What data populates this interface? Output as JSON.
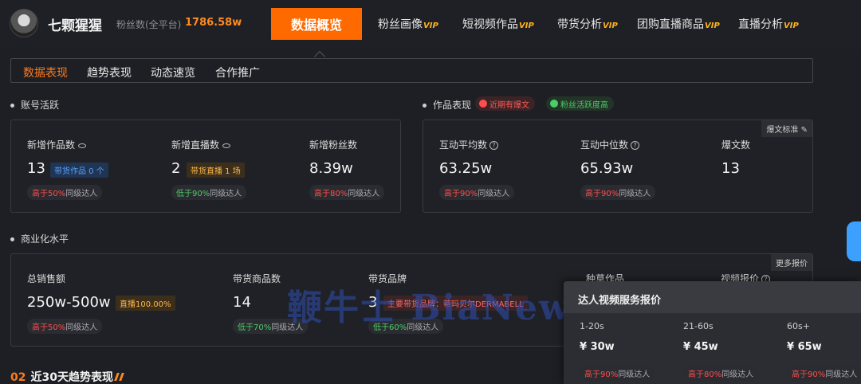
{
  "header": {
    "account_name": "七颗猩猩",
    "fans_label": "粉丝数(全平台)",
    "fans_value": "1786.58w",
    "nav_active": "数据概览",
    "nav_items": [
      {
        "label": "粉丝画像",
        "vip": "VIP"
      },
      {
        "label": "短视频作品",
        "vip": "VIP"
      },
      {
        "label": "带货分析",
        "vip": "VIP"
      },
      {
        "label": "团购直播商品",
        "vip": "VIP"
      },
      {
        "label": "直播分析",
        "vip": "VIP"
      }
    ]
  },
  "subtabs": [
    "数据表现",
    "趋势表现",
    "动态速览",
    "合作推广"
  ],
  "activity": {
    "title": "账号活跃",
    "metrics": [
      {
        "label": "新增作品数",
        "value": "13",
        "tag": "带货作品 0 个",
        "cmp_hl": "高于50%",
        "cmp_rest": "同级达人"
      },
      {
        "label": "新增直播数",
        "value": "2",
        "tag": "带货直播 1 场",
        "cmp_hl": "低于90%",
        "cmp_rest": "同级达人"
      },
      {
        "label": "新增粉丝数",
        "value": "8.39w",
        "cmp_hl": "高于80%",
        "cmp_rest": "同级达人"
      }
    ]
  },
  "works": {
    "title": "作品表现",
    "pill_red": "近期有爆文",
    "pill_green": "粉丝活跃度高",
    "corner": "爆文标准",
    "metrics": [
      {
        "label": "互动平均数",
        "value": "63.25w",
        "cmp_hl": "高于90%",
        "cmp_rest": "同级达人"
      },
      {
        "label": "互动中位数",
        "value": "65.93w",
        "cmp_hl": "高于90%",
        "cmp_rest": "同级达人"
      },
      {
        "label": "爆文数",
        "value": "13"
      }
    ]
  },
  "commerce": {
    "title": "商业化水平",
    "corner": "更多报价",
    "metrics": [
      {
        "label": "总销售额",
        "value": "250w-500w",
        "tag": "直播100.00%",
        "cmp_hl": "高于50%",
        "cmp_rest": "同级达人"
      },
      {
        "label": "带货商品数",
        "value": "14",
        "cmp_hl": "低于70%",
        "cmp_rest": "同级达人"
      },
      {
        "label": "带货品牌",
        "value": "3",
        "tag": "主要带货品牌：蒂玛贝尔DERMABELL",
        "cmp_hl": "低于60%",
        "cmp_rest": "同级达人"
      },
      {
        "label": "种草作品"
      },
      {
        "label": "视频报价"
      }
    ]
  },
  "watermark": "鞭牛士 BiaNews",
  "popup": {
    "title": "达人视频服务报价",
    "columns": [
      {
        "range": "1-20s",
        "price": "¥ 30w",
        "cmp_hl": "高于90%",
        "cmp_rest": "同级达人"
      },
      {
        "range": "21-60s",
        "price": "¥ 45w",
        "cmp_hl": "高于80%",
        "cmp_rest": "同级达人"
      },
      {
        "range": "60s+",
        "price": "¥ 65w",
        "cmp_hl": "高于90%",
        "cmp_rest": "同级达人"
      }
    ]
  },
  "trend": {
    "num": "02",
    "title": "近30天趋势表现"
  }
}
